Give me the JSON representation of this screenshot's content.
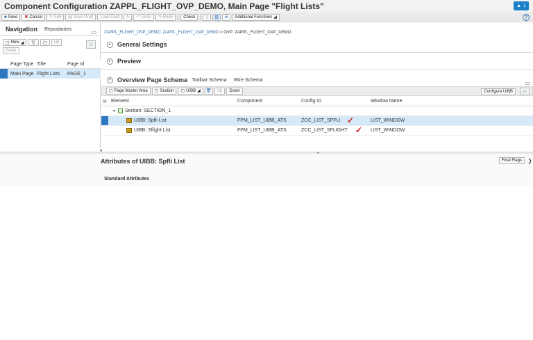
{
  "title": "Component Configuration ZAPPL_FLIGHT_OVP_DEMO, Main Page \"Flight Lists\"",
  "alert_count": "1",
  "toolbar": {
    "save": "Save",
    "cancel": "Cancel",
    "edit": "Edit",
    "save_draft": "Save Draft",
    "load_draft": "Load Draft",
    "undo": "Undo",
    "redo": "Redo",
    "check": "Check",
    "additional_functions": "Additional Functions"
  },
  "navigation": {
    "tab_navigation": "Navigation",
    "tab_repositories": "Repositories",
    "new_label": "New",
    "up_label": "Up",
    "down_label": "Down",
    "columns": [
      "Page Type",
      "Title",
      "Page Id"
    ],
    "rows": [
      {
        "page_type": "Main Page",
        "title": "Flight Lists",
        "page_id": "PAGE_1"
      }
    ]
  },
  "breadcrumb": {
    "link": "ZAPPL_FLIGHT_OVP_DEMO: ZAPPL_FLIGHT_OVP_DEMO",
    "separator": ">",
    "current": "OVP: ZAPPL_FLIGHT_OVP_DEMO"
  },
  "sections": {
    "general_settings": "General Settings",
    "preview": "Preview",
    "schema": "Overview Page Schema",
    "toolbar_schema": "Toolbar Schema",
    "wire_schema": "Wire Schema"
  },
  "ops_toolbar": {
    "page_master_area": "Page Master Area",
    "section": "Section",
    "uibb": "UIBB",
    "up": "Up",
    "down": "Down",
    "configure_uibb": "Configure UIBB"
  },
  "grid": {
    "columns": [
      "Element",
      "Component",
      "Config ID",
      "Window Name"
    ],
    "section_label": "Section: SECTION_1",
    "rows": [
      {
        "element": "UIBB: Spfli List",
        "component": "FPM_LIST_UIBB_ATS",
        "config_id": "ZCC_LIST_SPFLI",
        "window": "LIST_WINDOW"
      },
      {
        "element": "UIBB: Sflight List",
        "component": "FPM_LIST_UIBB_ATS",
        "config_id": "ZCC_LIST_SFLIGHT",
        "window": "LIST_WINDOW"
      }
    ]
  },
  "attributes": {
    "title": "Attributes of UIBB: Spfli List",
    "final_flags": "Final Flags",
    "standard_attributes": "Standard Attributes"
  },
  "colors": {
    "selection_blue": "#2f79c2",
    "row_highlight": "#d6e9f8",
    "accent": "#1a7ec9",
    "check_red": "#d01010"
  }
}
